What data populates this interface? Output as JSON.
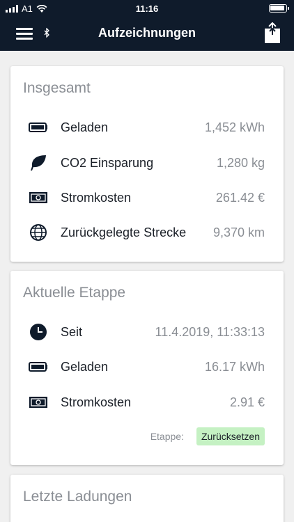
{
  "status": {
    "carrier": "A1",
    "time": "11:16"
  },
  "nav": {
    "title": "Aufzeichnungen"
  },
  "total": {
    "title": "Insgesamt",
    "rows": [
      {
        "icon": "battery-icon",
        "label": "Geladen",
        "value": "1,452 kWh"
      },
      {
        "icon": "leaf-icon",
        "label": "CO2 Einsparung",
        "value": "1,280 kg"
      },
      {
        "icon": "banknote-icon",
        "label": "Stromkosten",
        "value": "261.42 €"
      },
      {
        "icon": "globe-icon",
        "label": "Zurückgelegte Strecke",
        "value": "9,370 km"
      }
    ]
  },
  "stage": {
    "title": "Aktuelle Etappe",
    "rows": [
      {
        "icon": "clock-icon",
        "label": "Seit",
        "value": "11.4.2019, 11:33:13"
      },
      {
        "icon": "battery-icon",
        "label": "Geladen",
        "value": "16.17 kWh"
      },
      {
        "icon": "banknote-icon",
        "label": "Stromkosten",
        "value": "2.91 €"
      }
    ],
    "reset_label": "Etappe:",
    "reset_button": "Zurücksetzen"
  },
  "last": {
    "title": "Letzte Ladungen"
  }
}
